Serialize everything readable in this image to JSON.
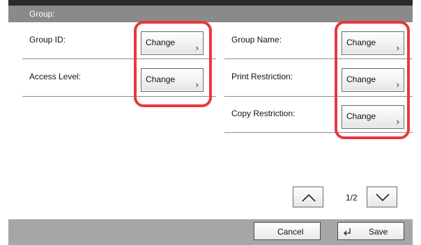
{
  "header": {
    "title": "Group:"
  },
  "fields": {
    "group_id": {
      "label": "Group ID:",
      "button": "Change"
    },
    "access_level": {
      "label": "Access Level:",
      "button": "Change"
    },
    "group_name": {
      "label": "Group Name:",
      "button": "Change"
    },
    "print_restriction": {
      "label": "Print Restriction:",
      "button": "Change"
    },
    "copy_restriction": {
      "label": "Copy Restriction:",
      "button": "Change"
    }
  },
  "pagination": {
    "indicator": "1/2",
    "up_icon": "chevron-up-icon",
    "down_icon": "chevron-down-icon"
  },
  "footer": {
    "cancel_label": "Cancel",
    "save_label": "Save",
    "save_icon": "enter-icon"
  },
  "colors": {
    "highlight": "#e8383d",
    "header_bg": "#8a8a8a",
    "footer_bg": "#a6a6a6"
  }
}
